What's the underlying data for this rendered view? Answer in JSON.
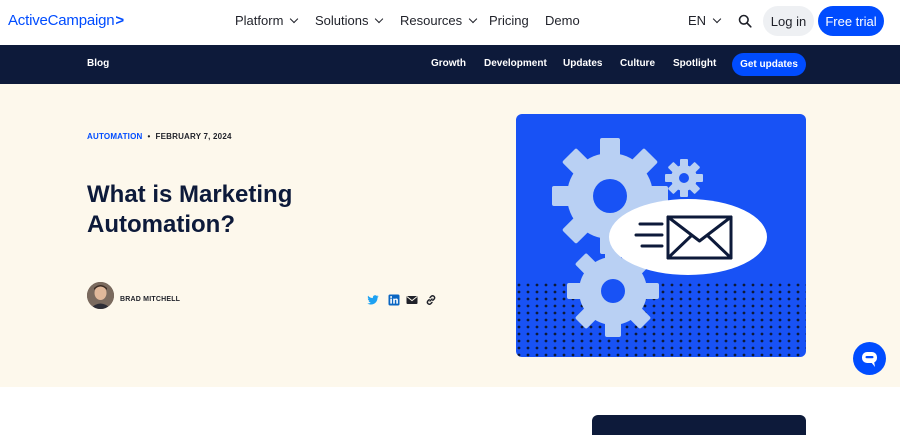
{
  "header": {
    "logo": "ActiveCampaign",
    "logo_mark": ">",
    "menu": [
      {
        "label": "Platform",
        "has_dropdown": true
      },
      {
        "label": "Solutions",
        "has_dropdown": true
      },
      {
        "label": "Resources",
        "has_dropdown": true
      },
      {
        "label": "Pricing",
        "has_dropdown": false
      },
      {
        "label": "Demo",
        "has_dropdown": false
      }
    ],
    "language": "EN",
    "search_icon": "search-icon",
    "login_label": "Log in",
    "trial_label": "Free trial"
  },
  "subnav": {
    "blog_label": "Blog",
    "links": [
      "Growth",
      "Development",
      "Updates",
      "Culture",
      "Spotlight"
    ],
    "cta_label": "Get updates"
  },
  "article": {
    "category": "AUTOMATION",
    "separator": "•",
    "date": "FEBRUARY 7, 2024",
    "title": "What is Marketing Automation?",
    "author": "BRAD MITCHELL",
    "share_icons": [
      "twitter-icon",
      "linkedin-icon",
      "email-icon",
      "link-icon"
    ]
  },
  "colors": {
    "brand_blue": "#004cff",
    "navy": "#0d1a3a",
    "hero_bg": "#fdf8ec",
    "illustration_blue": "#1852f5",
    "gear_light": "#b9d0f3"
  }
}
